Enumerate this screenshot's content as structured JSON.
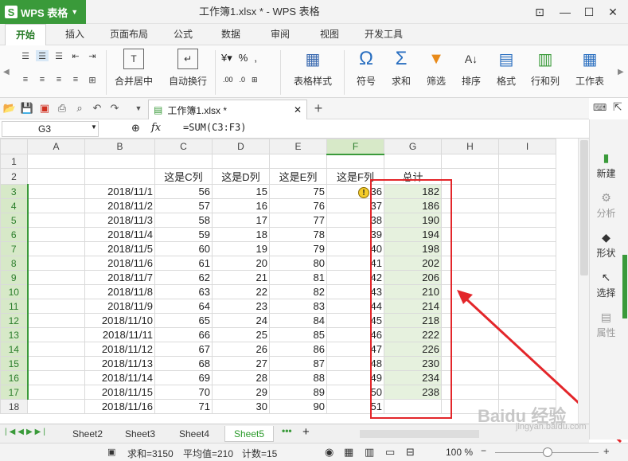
{
  "app": {
    "name": "WPS 表格",
    "title": "工作簿1.xlsx * - WPS 表格"
  },
  "menu": [
    "开始",
    "插入",
    "页面布局",
    "公式",
    "数据",
    "审阅",
    "视图",
    "开发工具"
  ],
  "ribbon": {
    "merge": "合并居中",
    "wrap": "自动换行",
    "table_style": "表格样式",
    "symbol": "符号",
    "sum": "求和",
    "filter": "筛选",
    "sort": "排序",
    "format": "格式",
    "rowcol": "行和列",
    "sheet": "工作表",
    "percent": "%"
  },
  "doc_tab": "工作簿1.xlsx *",
  "name_box": "G3",
  "fx": "fx",
  "formula": "=SUM(C3:F3)",
  "columns": [
    "A",
    "B",
    "C",
    "D",
    "E",
    "F",
    "G",
    "H",
    "I"
  ],
  "rows": [
    {
      "n": "1",
      "b": "",
      "c": "",
      "d": "",
      "e": "",
      "f": "",
      "g": ""
    },
    {
      "n": "2",
      "b": "",
      "c": "这是C列",
      "d": "这是D列",
      "e": "这是E列",
      "f": "这是F列",
      "g": "总计"
    },
    {
      "n": "3",
      "b": "2018/11/1",
      "c": "56",
      "d": "15",
      "e": "75",
      "f": "36",
      "g": "182"
    },
    {
      "n": "4",
      "b": "2018/11/2",
      "c": "57",
      "d": "16",
      "e": "76",
      "f": "37",
      "g": "186"
    },
    {
      "n": "5",
      "b": "2018/11/3",
      "c": "58",
      "d": "17",
      "e": "77",
      "f": "38",
      "g": "190"
    },
    {
      "n": "6",
      "b": "2018/11/4",
      "c": "59",
      "d": "18",
      "e": "78",
      "f": "39",
      "g": "194"
    },
    {
      "n": "7",
      "b": "2018/11/5",
      "c": "60",
      "d": "19",
      "e": "79",
      "f": "40",
      "g": "198"
    },
    {
      "n": "8",
      "b": "2018/11/6",
      "c": "61",
      "d": "20",
      "e": "80",
      "f": "41",
      "g": "202"
    },
    {
      "n": "9",
      "b": "2018/11/7",
      "c": "62",
      "d": "21",
      "e": "81",
      "f": "42",
      "g": "206"
    },
    {
      "n": "10",
      "b": "2018/11/8",
      "c": "63",
      "d": "22",
      "e": "82",
      "f": "43",
      "g": "210"
    },
    {
      "n": "11",
      "b": "2018/11/9",
      "c": "64",
      "d": "23",
      "e": "83",
      "f": "44",
      "g": "214"
    },
    {
      "n": "12",
      "b": "2018/11/10",
      "c": "65",
      "d": "24",
      "e": "84",
      "f": "45",
      "g": "218"
    },
    {
      "n": "13",
      "b": "2018/11/11",
      "c": "66",
      "d": "25",
      "e": "85",
      "f": "46",
      "g": "222"
    },
    {
      "n": "14",
      "b": "2018/11/12",
      "c": "67",
      "d": "26",
      "e": "86",
      "f": "47",
      "g": "226"
    },
    {
      "n": "15",
      "b": "2018/11/13",
      "c": "68",
      "d": "27",
      "e": "87",
      "f": "48",
      "g": "230"
    },
    {
      "n": "16",
      "b": "2018/11/14",
      "c": "69",
      "d": "28",
      "e": "88",
      "f": "49",
      "g": "234"
    },
    {
      "n": "17",
      "b": "2018/11/15",
      "c": "70",
      "d": "29",
      "e": "89",
      "f": "50",
      "g": "238"
    },
    {
      "n": "18",
      "b": "2018/11/16",
      "c": "71",
      "d": "30",
      "e": "90",
      "f": "51",
      "g": ""
    }
  ],
  "right_panel": [
    "新建",
    "分析",
    "形状",
    "选择",
    "属性"
  ],
  "sheets": [
    "Sheet2",
    "Sheet3",
    "Sheet4",
    "Sheet5"
  ],
  "status": {
    "sum": "求和=3150",
    "avg": "平均值=210",
    "count": "计数=15",
    "zoom": "100 %"
  },
  "watermark": "Baidu 经验",
  "watermark_url": "jingyan.baidu.com",
  "colors": {
    "accent": "#3a9a3a",
    "highlight": "#e3262a"
  }
}
